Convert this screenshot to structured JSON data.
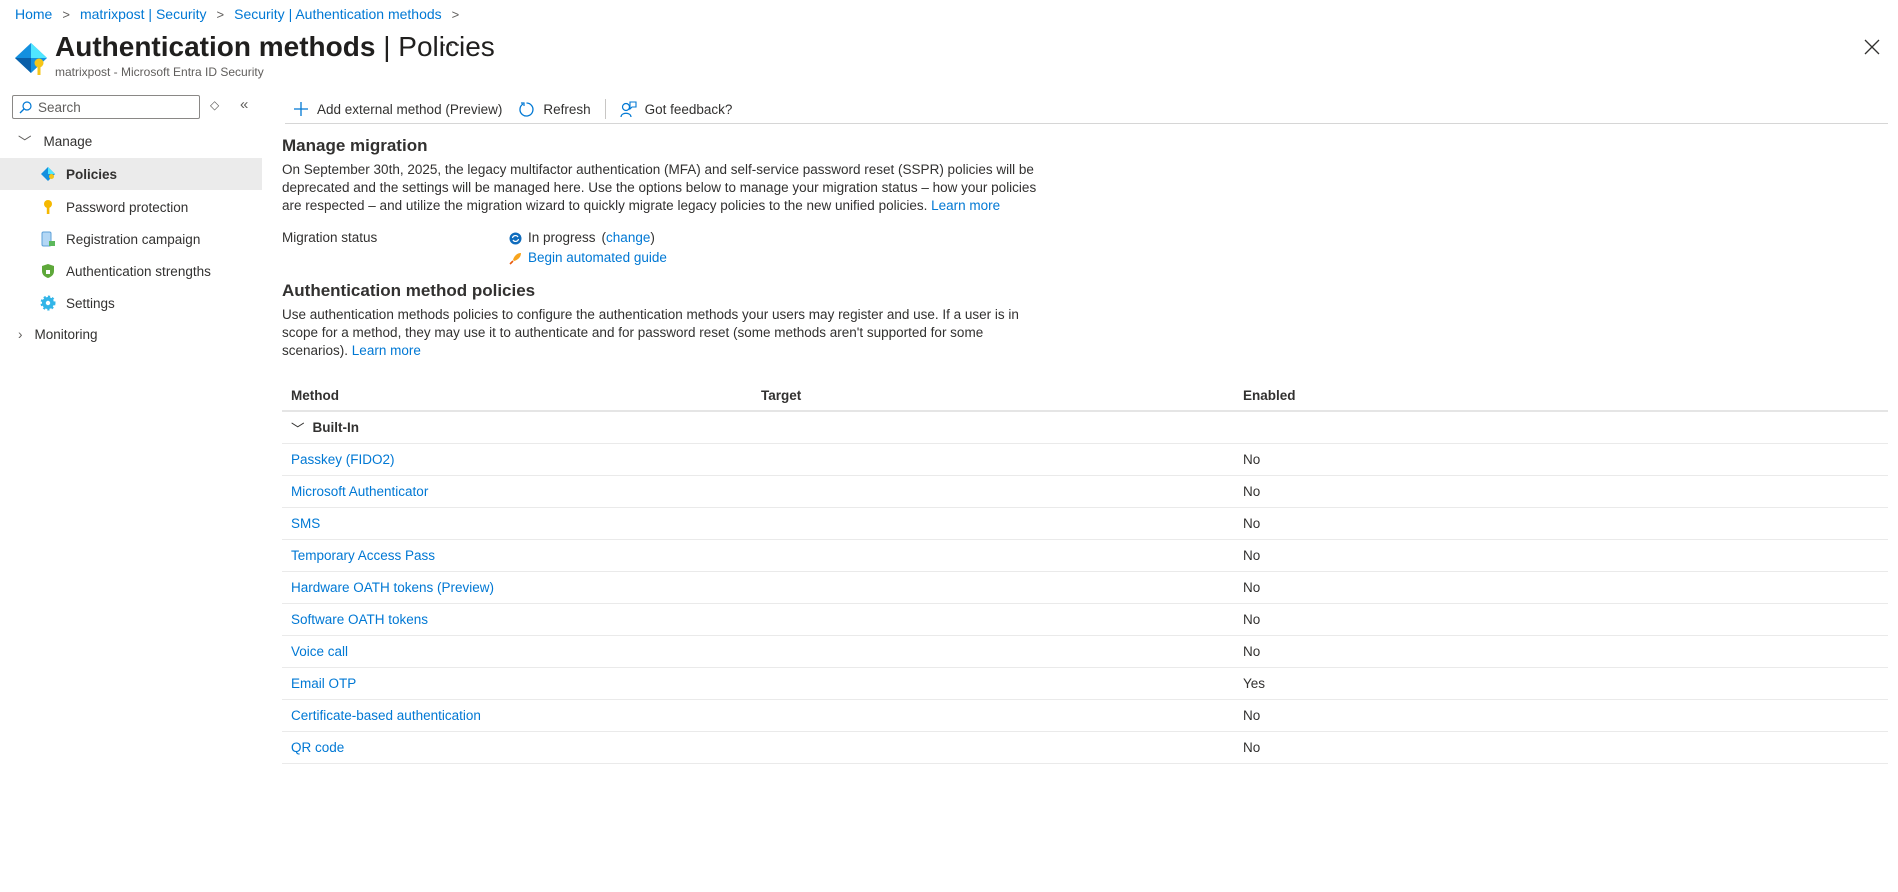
{
  "breadcrumb": [
    "Home",
    "matrixpost | Security",
    "Security | Authentication methods"
  ],
  "header": {
    "title_bold": "Authentication methods",
    "title_rest": " | Policies",
    "subtitle": "matrixpost - Microsoft Entra ID Security",
    "more": "···"
  },
  "sidebar": {
    "search_placeholder": "Search",
    "groups": [
      {
        "label": "Manage",
        "expanded": true
      },
      {
        "label": "Monitoring",
        "expanded": false
      }
    ],
    "items": [
      {
        "label": "Policies",
        "icon": "policies-icon",
        "selected": true
      },
      {
        "label": "Password protection",
        "icon": "key-icon"
      },
      {
        "label": "Registration campaign",
        "icon": "phone-check-icon"
      },
      {
        "label": "Authentication strengths",
        "icon": "shield-lock-icon"
      },
      {
        "label": "Settings",
        "icon": "gear-icon"
      }
    ]
  },
  "toolbar": {
    "add_label": "Add external method (Preview)",
    "refresh_label": "Refresh",
    "feedback_label": "Got feedback?"
  },
  "migration": {
    "heading": "Manage migration",
    "description": "On September 30th, 2025, the legacy multifactor authentication (MFA) and self-service password reset (SSPR) policies will be deprecated and the settings will be managed here. Use the options below to manage your migration status – how your policies are respected – and utilize the migration wizard to quickly migrate legacy policies to the new unified policies.",
    "learn_more": "Learn more",
    "status_label": "Migration status",
    "status_value": "In progress",
    "change_open": "(",
    "change_link": "change",
    "change_close": ")",
    "guide_link": "Begin automated guide"
  },
  "policies": {
    "heading": "Authentication method policies",
    "description": "Use authentication methods policies to configure the authentication methods your users may register and use. If a user is in scope for a method, they may use it to authenticate and for password reset (some methods aren't supported for some scenarios).",
    "learn_more": "Learn more"
  },
  "table": {
    "columns": [
      "Method",
      "Target",
      "Enabled"
    ],
    "group": "Built-In",
    "rows": [
      {
        "method": "Passkey (FIDO2)",
        "target": "",
        "enabled": "No"
      },
      {
        "method": "Microsoft Authenticator",
        "target": "",
        "enabled": "No"
      },
      {
        "method": "SMS",
        "target": "",
        "enabled": "No"
      },
      {
        "method": "Temporary Access Pass",
        "target": "",
        "enabled": "No"
      },
      {
        "method": "Hardware OATH tokens (Preview)",
        "target": "",
        "enabled": "No"
      },
      {
        "method": "Software OATH tokens",
        "target": "",
        "enabled": "No"
      },
      {
        "method": "Voice call",
        "target": "",
        "enabled": "No"
      },
      {
        "method": "Email OTP",
        "target": "",
        "enabled": "Yes"
      },
      {
        "method": "Certificate-based authentication",
        "target": "",
        "enabled": "No"
      },
      {
        "method": "QR code",
        "target": "",
        "enabled": "No"
      }
    ]
  },
  "colors": {
    "link": "#0078d4",
    "text": "#323130",
    "selected_bg": "#ebebeb"
  }
}
